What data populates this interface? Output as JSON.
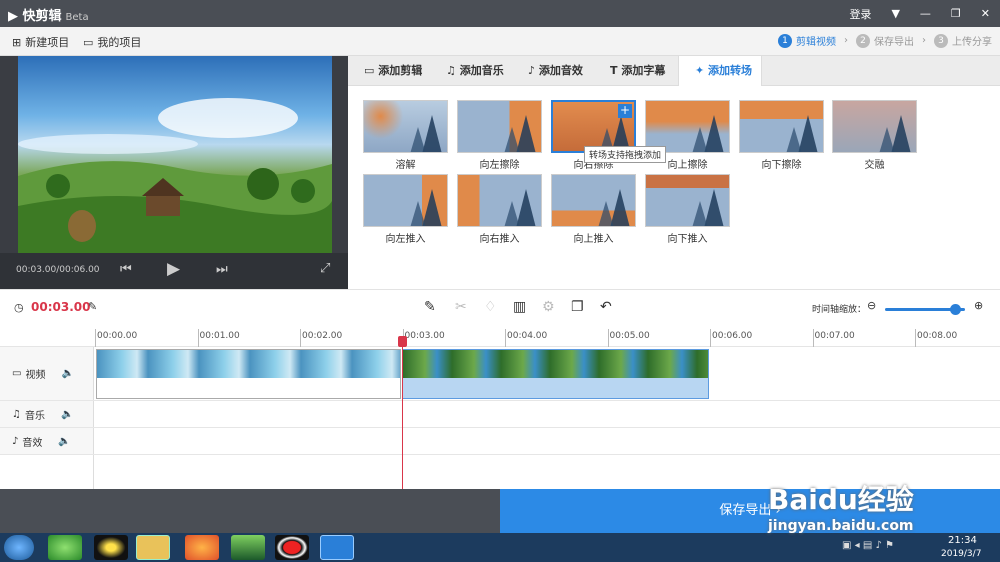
{
  "app": {
    "name": "快剪辑",
    "badge": "Beta"
  },
  "titlebar": {
    "login": "登录"
  },
  "toolbar": {
    "new_project": "新建项目",
    "my_projects": "我的项目"
  },
  "steps": [
    {
      "num": "1",
      "label": "剪辑视频"
    },
    {
      "num": "2",
      "label": "保存导出"
    },
    {
      "num": "3",
      "label": "上传分享"
    }
  ],
  "preview": {
    "time": "00:03.00/00:06.00"
  },
  "tabs": [
    "添加剪辑",
    "添加音乐",
    "添加音效",
    "添加字幕",
    "添加转场"
  ],
  "transitions": [
    {
      "label": "溶解",
      "scheme": "dissolve"
    },
    {
      "label": "向左擦除",
      "scheme": "wipe-left"
    },
    {
      "label": "向右擦除",
      "scheme": "wipe-right"
    },
    {
      "label": "向上擦除",
      "scheme": "wipe-up"
    },
    {
      "label": "向下擦除",
      "scheme": "wipe-down"
    },
    {
      "label": "交融",
      "scheme": "blend"
    },
    {
      "label": "向左推入",
      "scheme": "push-left"
    },
    {
      "label": "向右推入",
      "scheme": "push-right"
    },
    {
      "label": "向上推入",
      "scheme": "push-up"
    },
    {
      "label": "向下推入",
      "scheme": "push-down"
    }
  ],
  "tooltip": "转场支持拖拽添加",
  "editor": {
    "time": "00:03.00",
    "zoom_label": "时间轴缩放："
  },
  "ruler": [
    "00:00.00",
    "00:01.00",
    "00:02.00",
    "00:03.00",
    "00:04.00",
    "00:05.00",
    "00:06.00",
    "00:07.00",
    "00:08.00"
  ],
  "tracks": [
    "视频",
    "音乐",
    "音效"
  ],
  "footer": {
    "save": "保存导出"
  },
  "taskbar": {
    "time": "21:34",
    "date": "2019/3/7"
  },
  "watermark": {
    "brand": "Baidu经验",
    "url": "jingyan.baidu.com"
  },
  "colors": {
    "accent": "#2a7fd8",
    "title": "#4a4e55",
    "playhead": "#d9364a",
    "save": "#2c8ae6"
  }
}
